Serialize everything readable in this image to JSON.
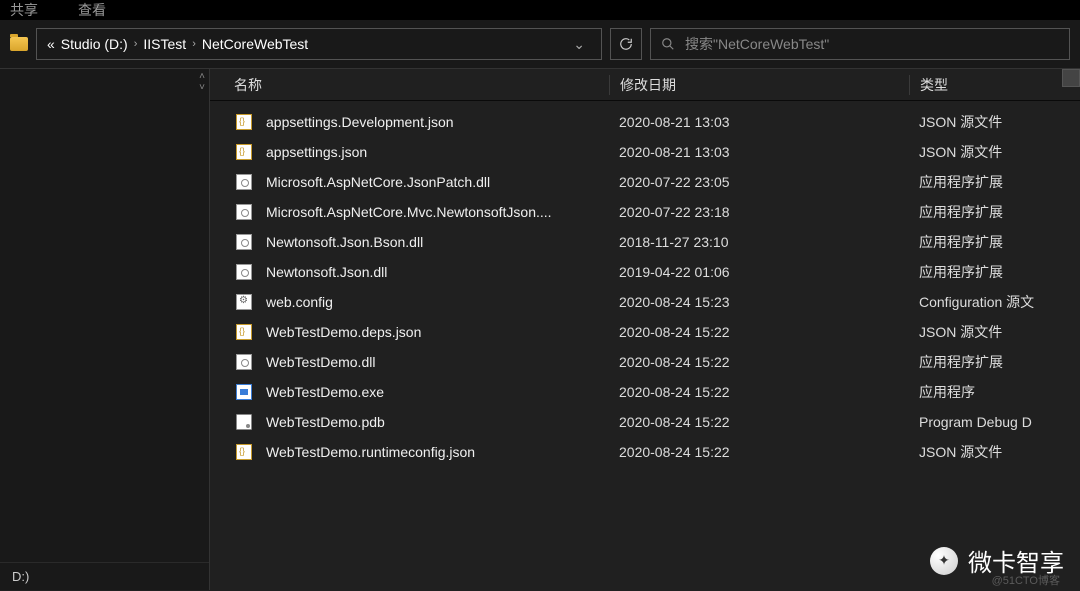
{
  "menu": {
    "item1": "共享",
    "item2": "查看"
  },
  "breadcrumb": {
    "ellipsis": "«",
    "items": [
      "Studio (D:)",
      "IISTest",
      "NetCoreWebTest"
    ]
  },
  "search": {
    "placeholder": "搜索\"NetCoreWebTest\""
  },
  "columns": {
    "name": "名称",
    "date": "修改日期",
    "type": "类型"
  },
  "nav": {
    "drive": "D:)"
  },
  "files": [
    {
      "icon": "json",
      "name": "appsettings.Development.json",
      "date": "2020-08-21 13:03",
      "type": "JSON 源文件"
    },
    {
      "icon": "json",
      "name": "appsettings.json",
      "date": "2020-08-21 13:03",
      "type": "JSON 源文件"
    },
    {
      "icon": "dll",
      "name": "Microsoft.AspNetCore.JsonPatch.dll",
      "date": "2020-07-22 23:05",
      "type": "应用程序扩展"
    },
    {
      "icon": "dll",
      "name": "Microsoft.AspNetCore.Mvc.NewtonsoftJson....",
      "date": "2020-07-22 23:18",
      "type": "应用程序扩展"
    },
    {
      "icon": "dll",
      "name": "Newtonsoft.Json.Bson.dll",
      "date": "2018-11-27 23:10",
      "type": "应用程序扩展"
    },
    {
      "icon": "dll",
      "name": "Newtonsoft.Json.dll",
      "date": "2019-04-22 01:06",
      "type": "应用程序扩展"
    },
    {
      "icon": "config",
      "name": "web.config",
      "date": "2020-08-24 15:23",
      "type": "Configuration 源文"
    },
    {
      "icon": "json",
      "name": "WebTestDemo.deps.json",
      "date": "2020-08-24 15:22",
      "type": "JSON 源文件"
    },
    {
      "icon": "dll",
      "name": "WebTestDemo.dll",
      "date": "2020-08-24 15:22",
      "type": "应用程序扩展"
    },
    {
      "icon": "exe",
      "name": "WebTestDemo.exe",
      "date": "2020-08-24 15:22",
      "type": "应用程序"
    },
    {
      "icon": "pdb",
      "name": "WebTestDemo.pdb",
      "date": "2020-08-24 15:22",
      "type": "Program Debug D"
    },
    {
      "icon": "json",
      "name": "WebTestDemo.runtimeconfig.json",
      "date": "2020-08-24 15:22",
      "type": "JSON 源文件"
    }
  ],
  "watermark": {
    "text": "微卡智享",
    "credit": "@51CTO博客"
  }
}
